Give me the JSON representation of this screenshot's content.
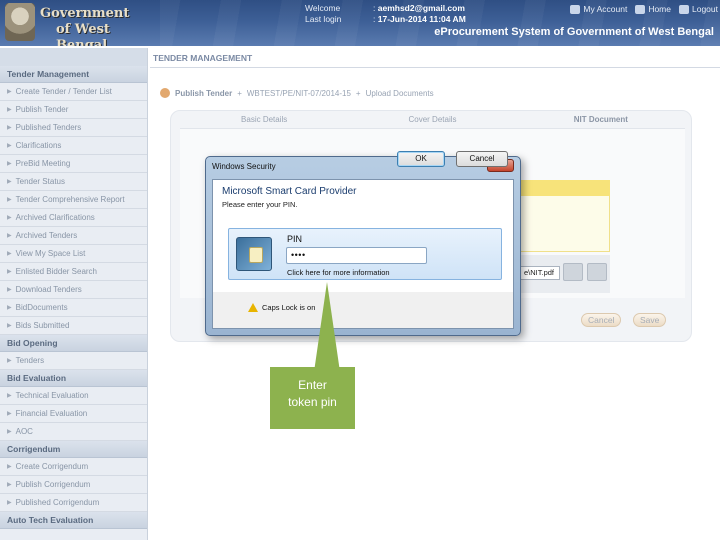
{
  "header": {
    "gov_title_line1": "Government",
    "gov_title_line2": "of West Bengal",
    "welcome_label": "Welcome",
    "welcome_value": "aemhsd2@gmail.com",
    "last_login_label": "Last login",
    "last_login_value": "17-Jun-2014 11:04 AM",
    "links": [
      "My Account",
      "Home",
      "Logout"
    ],
    "portal_title": "eProcurement System of Government of West Bengal"
  },
  "sidebar": {
    "sections": [
      {
        "heading": "Tender Management",
        "items": [
          "Create Tender / Tender List",
          "Publish Tender",
          "Published Tenders",
          "Clarifications",
          "PreBid Meeting",
          "Tender Status",
          "Tender Comprehensive Report",
          "Archived Clarifications",
          "Archived Tenders",
          "View My Space List",
          "Enlisted Bidder Search",
          "Download Tenders",
          "BidDocuments",
          "Bids Submitted"
        ]
      },
      {
        "heading": "Bid Opening",
        "items": [
          "Tenders"
        ]
      },
      {
        "heading": "Bid Evaluation",
        "items": [
          "Technical Evaluation",
          "Financial Evaluation",
          "AOC"
        ]
      },
      {
        "heading": "Corrigendum",
        "items": [
          "Create Corrigendum",
          "Publish Corrigendum",
          "Published Corrigendum"
        ]
      },
      {
        "heading": "Auto Tech Evaluation",
        "items": []
      }
    ]
  },
  "main": {
    "title": "TENDER MANAGEMENT",
    "breadcrumb": [
      "Publish Tender",
      "WBTEST/PE/NIT-07/2014-15",
      "Upload Documents"
    ],
    "tabs": [
      "Basic Details",
      "Cover Details",
      "NIT Document"
    ],
    "file_value": "e\\NIT.pdf",
    "cancel_label": "Cancel",
    "save_label": "Save"
  },
  "dialog": {
    "title": "Windows Security",
    "close_glyph": "×",
    "heading": "Microsoft Smart Card Provider",
    "subtitle": "Please enter your PIN.",
    "pin_label": "PIN",
    "pin_value": "••••",
    "link_text": "Click here for more information",
    "warning": "Caps Lock is on",
    "ok_label": "OK",
    "cancel_label": "Cancel"
  },
  "callout": {
    "line1": "Enter",
    "line2": "token pin"
  },
  "colors": {
    "header": "#3d5f96",
    "callout": "#8db24e",
    "dialog_frame": "#9ab4d1"
  }
}
